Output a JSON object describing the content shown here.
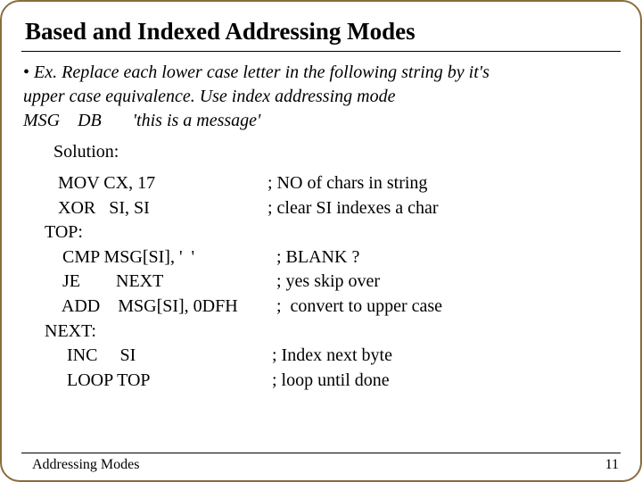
{
  "title": "Based and Indexed Addressing Modes",
  "intro": {
    "bullet": "•",
    "line1": "Ex. Replace each lower case letter in the following string by it's",
    "line2": "upper case equivalence. Use index addressing mode",
    "line3": "MSG    DB       'this is a message'"
  },
  "solution_label": "Solution:",
  "code": {
    "r1_instr": "   MOV CX, 17",
    "r1_comment": "; NO of chars in string",
    "r2_instr": "   XOR   SI, SI",
    "r2_comment": "; clear SI indexes a char",
    "r3_label": "TOP:",
    "r4_instr": "    CMP MSG[SI], '  '",
    "r4_comment": "  ; BLANK ?",
    "r5_instr": "    JE        NEXT",
    "r5_comment": "  ; yes skip over",
    "r6_instr": "    ADD    MSG[SI], 0DFH",
    "r6_comment": "  ;  convert to upper case",
    "r7_label": "NEXT:",
    "r8_instr": "     INC     SI",
    "r8_comment": " ; Index next byte",
    "r9_instr": "     LOOP TOP",
    "r9_comment": " ; loop until done"
  },
  "footer": {
    "left": "Addressing Modes",
    "right": "11"
  }
}
